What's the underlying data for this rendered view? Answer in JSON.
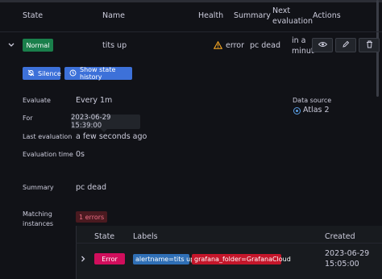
{
  "table": {
    "headers": {
      "state": "State",
      "name": "Name",
      "health": "Health",
      "summary": "Summary",
      "next_evaluation_line1": "Next",
      "next_evaluation_line2": "evaluation",
      "actions": "Actions"
    },
    "row": {
      "state": "Normal",
      "name": "tits up",
      "health": "error",
      "summary": "pc dead",
      "next_evaluation_line1": "in a",
      "next_evaluation_line2": "minut"
    }
  },
  "buttons": {
    "silence": "Silence",
    "show_state_history": "Show state history"
  },
  "details": {
    "evaluate_label": "Evaluate",
    "evaluate_value": "Every 1m",
    "for_label": "For",
    "tooltip": "2023-06-29 15:39:00",
    "last_eval_label": "Last evaluation",
    "last_eval_value": "a few seconds ago",
    "eval_time_label": "Evaluation time",
    "eval_time_value": "0s",
    "summary_label": "Summary",
    "summary_value": "pc dead",
    "matching_line1": "Matching",
    "matching_line2": "instances",
    "errors_badge": "1 errors",
    "datasource_label": "Data source",
    "datasource_value": "Atlas 2"
  },
  "instances": {
    "headers": {
      "state": "State",
      "labels": "Labels",
      "created": "Created"
    },
    "row": {
      "state": "Error",
      "labels": [
        "alertname=tits up",
        "grafana_folder=GrafanaCloud"
      ],
      "created_date": "2023-06-29",
      "created_time": "15:05:00"
    }
  },
  "colors": {
    "normal": "#1a7f4b",
    "error_pill": "#d10e5c",
    "blue_button": "#3d71d9",
    "health_warning": "#f5a623",
    "label_alertname": "#2f6fb5",
    "label_folder": "#c4162a"
  },
  "icons": {
    "expand": "chevron-down",
    "health": "warning-triangle",
    "silence": "bell-slash",
    "history": "history",
    "view": "eye",
    "edit": "pencil",
    "delete": "trash",
    "datasource": "atlas-logo",
    "instance_expand": "chevron-right"
  }
}
